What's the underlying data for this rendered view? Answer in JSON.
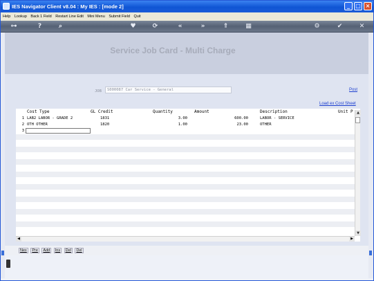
{
  "window": {
    "title": "IES Navigator Client v8.04 : My IES :      [mode 2]",
    "controls": {
      "minimize": "_",
      "maximize": "□",
      "close": "×"
    }
  },
  "menu": {
    "items": [
      "Help",
      "Lookup",
      "Back 1 Field",
      "Restart Line Edit",
      "Mini Menu",
      "Submit Field",
      "Quit"
    ]
  },
  "toolbar": {
    "icons": [
      "key-icon",
      "help-icon",
      "search-icon",
      "heart-icon",
      "refresh-icon",
      "rewind-icon",
      "forward-icon",
      "export-icon",
      "grid-icon",
      "settings-icon",
      "check-icon",
      "close-icon"
    ]
  },
  "page": {
    "title": "Service Job Card - Multi Charge",
    "job_prefix": "JOB",
    "job_value": "S000087 Car Service - General",
    "post_link": "Post",
    "load_link": "Load ex Cost Sheet"
  },
  "grid": {
    "columns": [
      "Cost Type",
      "GL Credit",
      "Quantity",
      "Amount",
      "Description",
      "Unit P"
    ],
    "rows": [
      {
        "n": "1",
        "cost_type": "LAB2 LABOR - GRADE 2",
        "gl_credit": "1831",
        "quantity": "3.00",
        "amount": "600.00",
        "description": "LABOR - SERVICE"
      },
      {
        "n": "2",
        "cost_type": "OTH OTHER",
        "gl_credit": "1820",
        "quantity": "1.00",
        "amount": "23.00",
        "description": "OTHER"
      },
      {
        "n": "3",
        "cost_type": "",
        "gl_credit": "",
        "quantity": "",
        "amount": "",
        "description": ""
      }
    ]
  },
  "bottom": {
    "buttons": [
      "Nex",
      "Pre",
      "Add",
      "Ins",
      "Del",
      "Del"
    ]
  },
  "colors": {
    "title_bar": "#0f55d4",
    "link": "#1c3fd0",
    "page_title": "#a7acba"
  }
}
